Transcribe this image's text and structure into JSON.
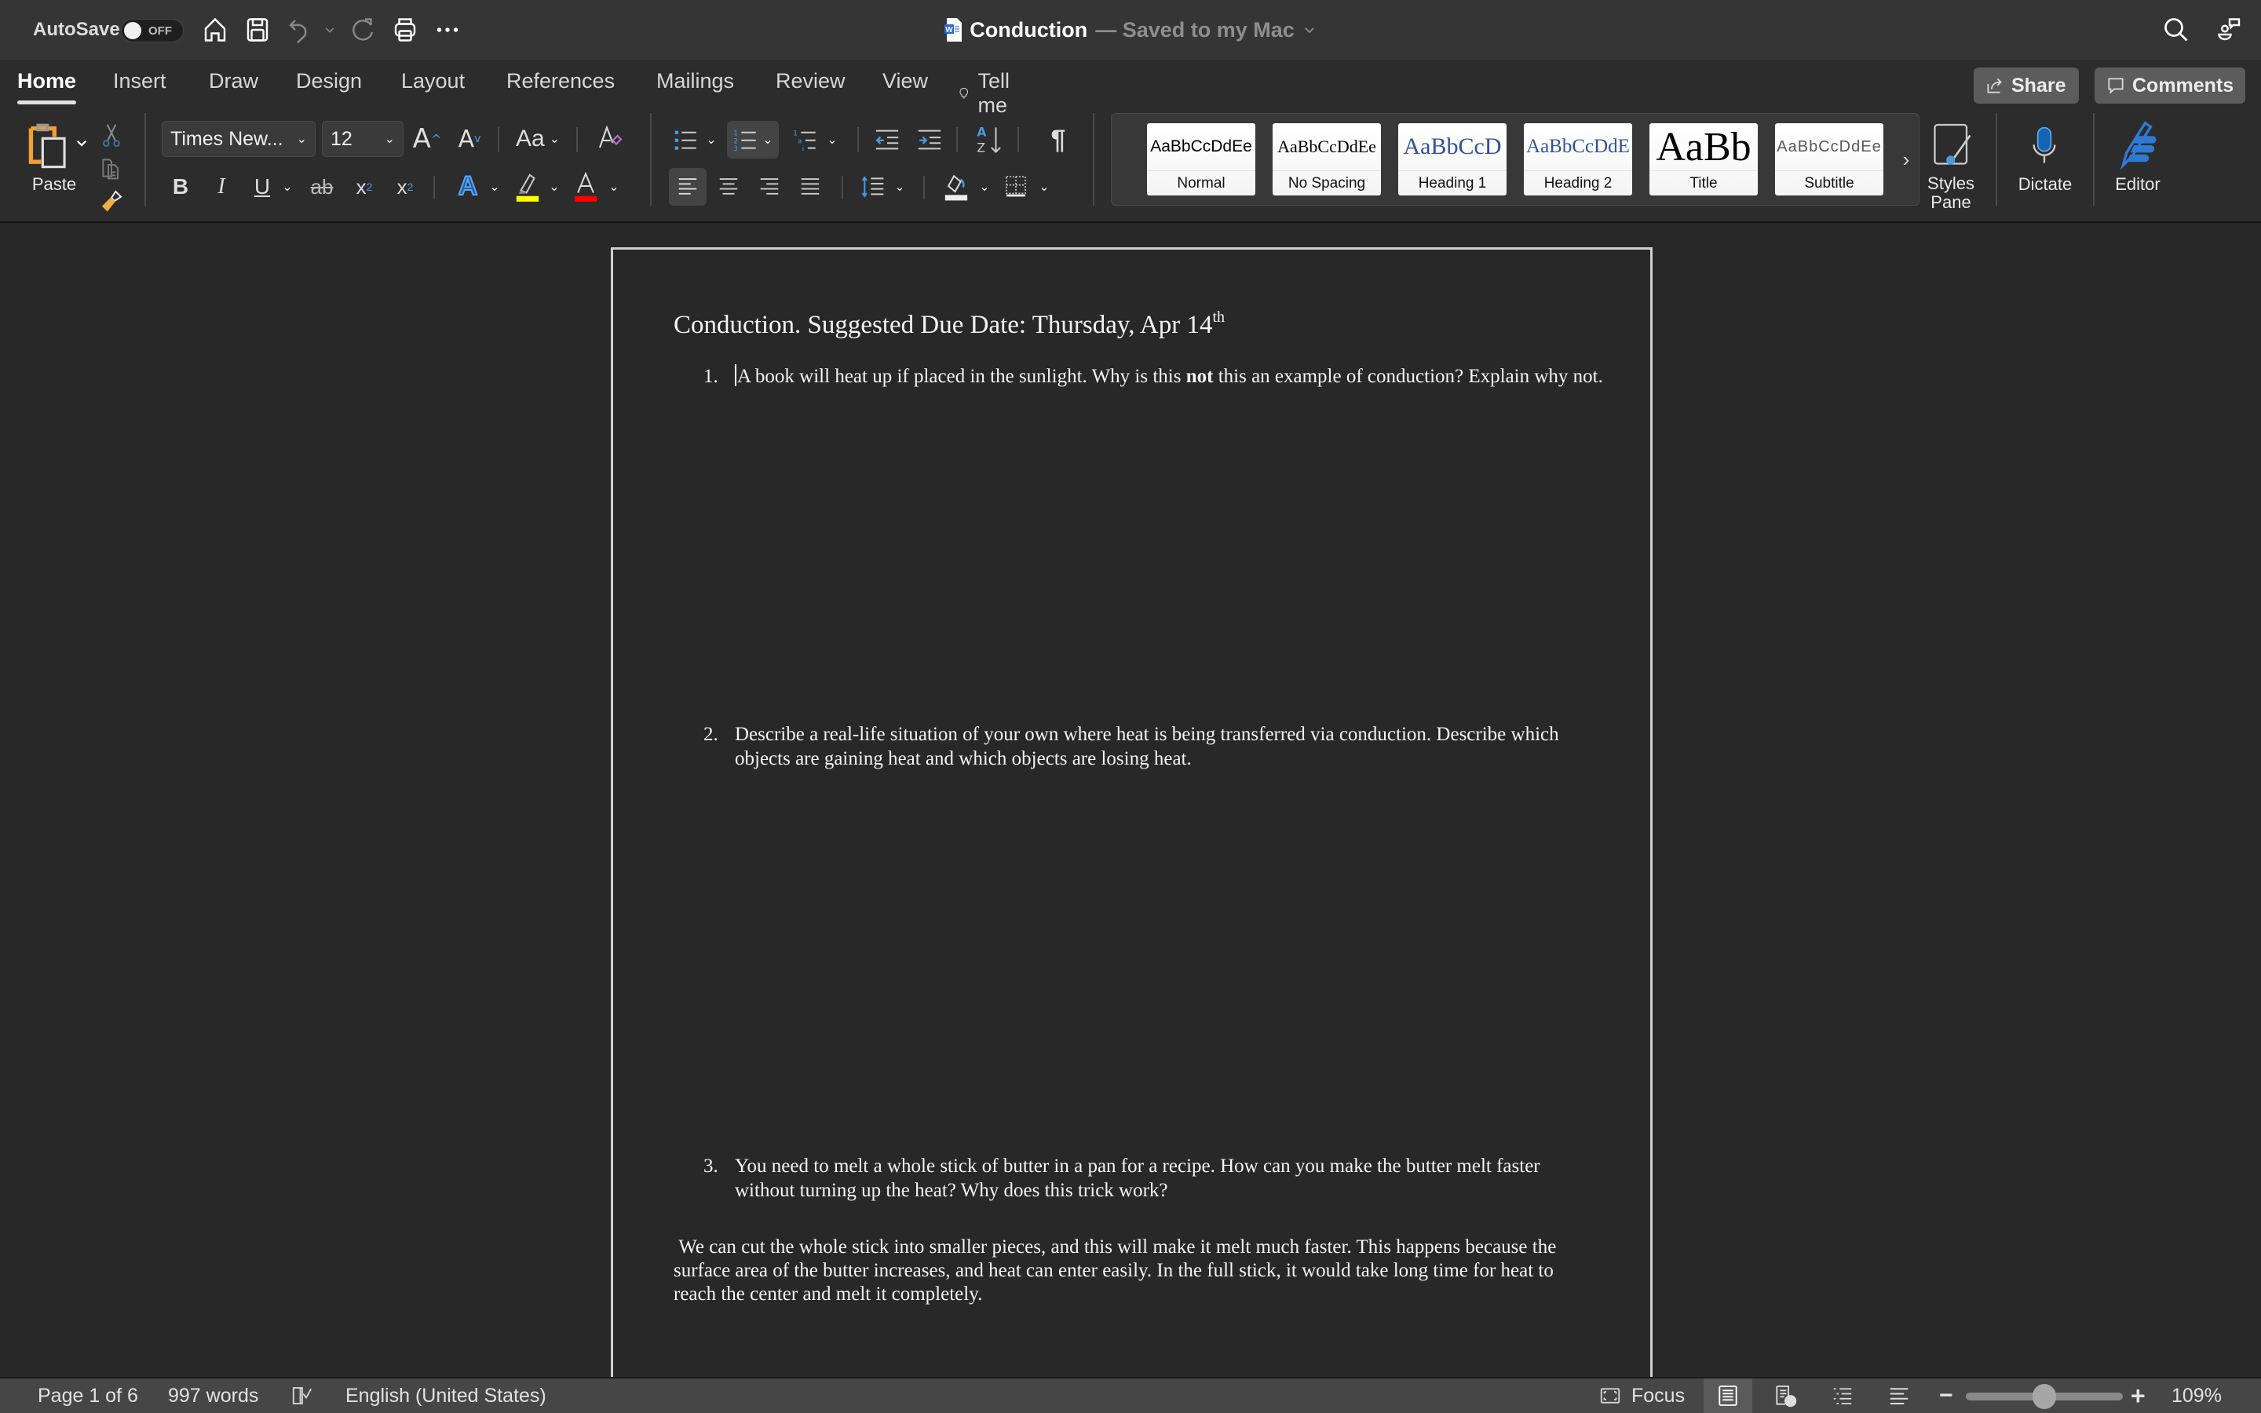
{
  "titlebar": {
    "autosave_label": "AutoSave",
    "autosave_state": "OFF",
    "doc_name": "Conduction",
    "doc_status": "— Saved to my Mac",
    "icons": [
      "home-icon",
      "save-icon",
      "undo-icon",
      "redo-icon",
      "print-icon",
      "more-icon",
      "search-icon",
      "collaborate-icon"
    ]
  },
  "tabs": [
    {
      "label": "Home",
      "active": true
    },
    {
      "label": "Insert"
    },
    {
      "label": "Draw"
    },
    {
      "label": "Design"
    },
    {
      "label": "Layout"
    },
    {
      "label": "References"
    },
    {
      "label": "Mailings"
    },
    {
      "label": "Review"
    },
    {
      "label": "View"
    },
    {
      "label": "Tell me"
    }
  ],
  "header_buttons": {
    "share": "Share",
    "comments": "Comments"
  },
  "ribbon": {
    "paste_label": "Paste",
    "font_name": "Times New...",
    "font_size": "12",
    "change_case": "Aa",
    "bold": "B",
    "italic": "I",
    "underline": "U",
    "highlight_color": "#ffff00",
    "font_color": "#ff0000",
    "styles": [
      {
        "name": "Normal",
        "sample": "AaBbCcDdEe"
      },
      {
        "name": "No Spacing",
        "sample": "AaBbCcDdEe"
      },
      {
        "name": "Heading 1",
        "sample": "AaBbCcD"
      },
      {
        "name": "Heading 2",
        "sample": "AaBbCcDdE"
      },
      {
        "name": "Title",
        "sample": "AaBb"
      },
      {
        "name": "Subtitle",
        "sample": "AaBbCcDdEe"
      }
    ],
    "styles_pane_label_1": "Styles",
    "styles_pane_label_2": "Pane",
    "dictate_label": "Dictate",
    "editor_label": "Editor"
  },
  "document": {
    "heading": "Conduction. Suggested Due Date: Thursday, Apr 14",
    "heading_sup": "th",
    "questions": [
      {
        "number": "1.",
        "text_before_bold": "A book will heat up if placed in the sunlight. Why is this ",
        "bold": "not",
        "text_after_bold": " this an example of conduction? Explain why not."
      },
      {
        "number": "2.",
        "text": "Describe a real-life situation of your own where heat is being transferred via conduction. Describe which objects are gaining heat and which objects are losing heat."
      },
      {
        "number": "3.",
        "text": "You need to melt a whole stick of butter in a pan for a recipe. How can you make the butter melt faster without turning up the heat? Why does this trick work?"
      }
    ],
    "answer": " We can cut the whole stick into smaller pieces, and this will make it melt much faster. This happens because the surface area of the butter increases, and heat can enter easily. In the full stick, it would take long time for heat to reach the center and melt it completely."
  },
  "statusbar": {
    "page": "Page 1 of 6",
    "words": "997 words",
    "language": "English (United States)",
    "focus": "Focus",
    "zoom": "109%",
    "zoom_fraction": 0.5
  }
}
